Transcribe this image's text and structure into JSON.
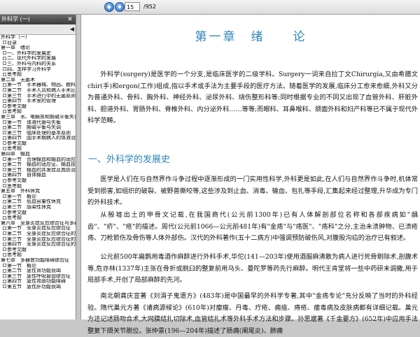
{
  "toolbar": {
    "current_page": "15",
    "total_pages": "952"
  },
  "sidebar": {
    "title": "外科学 (一)",
    "items": [
      {
        "label": "外科学（一）",
        "level": 0
      },
      {
        "label": "目录",
        "level": 1
      },
      {
        "label": "第一章　绪论",
        "level": 0
      },
      {
        "label": "一、外科学的发展史",
        "level": 1
      },
      {
        "label": "二、现代外科学的发展",
        "level": 1
      },
      {
        "label": "三、外科与内科的关系",
        "level": 1
      },
      {
        "label": "四、怎样学习外科学",
        "level": 1
      },
      {
        "label": "思考题",
        "level": 1
      },
      {
        "label": "第二章　无菌术",
        "level": 0
      },
      {
        "label": "第一节　手术器械、物品、敷料",
        "level": 1
      },
      {
        "label": "第二节　手术人员和病人手术区域",
        "level": 1
      },
      {
        "label": "第三节　手术进行中的无菌原则",
        "level": 1
      },
      {
        "label": "第四节　手术室的管理",
        "level": 1
      },
      {
        "label": "参考文献",
        "level": 1
      },
      {
        "label": "思考题",
        "level": 1
      },
      {
        "label": "第三章　水、电解质和酸碱平衡失调",
        "level": 0
      },
      {
        "label": "第一节　体液代谢与失衡",
        "level": 1
      },
      {
        "label": "第二节　酸碱平衡与失调",
        "level": 1
      },
      {
        "label": "第三节　临床处理的基本原则",
        "level": 1
      },
      {
        "label": "第四节　围手术期病人的体液治疗",
        "level": 1
      },
      {
        "label": "参考文献",
        "level": 1
      },
      {
        "label": "思考题",
        "level": 1
      },
      {
        "label": "第四章　输血",
        "level": 0
      },
      {
        "label": "第一节　合理输血和输血的适应证",
        "level": 1
      },
      {
        "label": "第二节　输血的适应证、输血技术",
        "level": 1
      },
      {
        "label": "第三节　输血的并发症及其防治",
        "level": 1
      },
      {
        "label": "第四节　自体输血",
        "level": 1
      },
      {
        "label": "参考文献",
        "level": 1
      },
      {
        "label": "思考题",
        "level": 1
      },
      {
        "label": "第五章　外科休克",
        "level": 0
      },
      {
        "label": "第一节　概论",
        "level": 1
      },
      {
        "label": "第二节　低血容量性休克",
        "level": 1
      },
      {
        "label": "第三节　感染性休克",
        "level": 1
      },
      {
        "label": "参考文献",
        "level": 1
      },
      {
        "label": "思考题",
        "level": 1
      },
      {
        "label": "第六章　全身炎症反应综合征与多器官",
        "level": 0
      },
      {
        "label": "第一节　全身炎症反应综合征",
        "level": 1
      },
      {
        "label": "第二节　全身炎症反应综合征的",
        "level": 1
      },
      {
        "label": "第三节　全身炎症反应综合征的",
        "level": 1
      },
      {
        "label": "第四节　全身炎症反应综合征的",
        "level": 1
      },
      {
        "label": "参考文献",
        "level": 1
      },
      {
        "label": "思考题",
        "level": 1
      },
      {
        "label": "第七章　多器官功能障碍综合征",
        "level": 0
      },
      {
        "label": "第一节　概论",
        "level": 1
      },
      {
        "label": "第二节　急性肾功能衰竭",
        "level": 1
      },
      {
        "label": "第三节　急性呼吸窘迫综合征",
        "level": 1
      },
      {
        "label": "第四节　急性胃肠功能障碍",
        "level": 1
      },
      {
        "label": "第五节　急性肝功能衰竭",
        "level": 1
      }
    ]
  },
  "page": {
    "chapter_title": "第一章　绪　　论",
    "intro_paragraph": "外科学(surgery)是医学的一个分支,是临床医学的二级学科。Surgery一词来自拉丁文Chirurgia,又由希腊文chir(手)和ergon(工作)组成,指以手术或手法为主要手段的医疗方法。随着医学的发展,临床分工愈来愈细,外科又分为普通外科、骨科、胸外科、神经外科、泌尿外科、烧伤整形科等;同时根据专业的不同又出现了血管外科、肝脏外科、胆道外科、胃肠外科、脊椎外科、内分泌外科……等等;而眼科、耳鼻喉科、颌面外科和妇产科等已不属于现代外科学范畴。",
    "section_heading": "一、外科学的发展史",
    "para_1": "医学是人们在与自然界作斗争过程中逐渐形成的一门实用性科学,外科更是如此,在人们与自然界作斗争时,机体常受到损害,如组织的破裂、被野兽撕咬等,这些涉及到止血、消毒、输血、包扎等手段,汇集起来经过整理,升华成为专门的外科技术。",
    "para_2": "从殷墟出土的甲骨文记载,在我国商代(公元前1300年)已有人体解剖部位名称和各部疾病如\"龋齿\"、\"疥\"、\"疮\"的描述。周代(公元前1066—公元前481年)有\"金疡\"与\"疡医\"、\"疡科\"之分,主治未溃肿物、已溃疮疡、刀枪箭伤及骨伤等人体外部伤。汉代的外科著作(五十二病方)中强调预防破伤风,对腹股沟疝的治疗已有叙述。",
    "para_3": "公元前500年扁鹊用毒酒作麻醉进行外科手术,华佗(141—203年)使用酒服麻沸散为病人进行死骨剔除术,剖腹术等,危亦林(1337年)主张在骨折或脱臼的整复前用乌头、曼陀罗等药先行麻醉。明代王肯堂将一些中药研末调撒,用于局部手术,开创了局部麻醉的先河。",
    "para_4": "南北朝龚庆宣著《刘涓子鬼遗方》(483年)是中国最早的外科学专著,其中\"金疡专论\"充分反映了当时的外科经验。隋代巢元方著《诸病源候论》(610年)对瘿瘤、丹毒、疔疮、痈疽、痔疮、痿毒病及皮肤病都有详细记载。巢元方还记述肠吻合术,大网膜结扎切除术,血管结扎术等外科手术方法和步骤。孙思邈著《千金要方》(652年)中应用手法整复下颌关节脱位。张仲景(196—204年)描述了肠痈(阑尾炎)、肺痈"
  }
}
